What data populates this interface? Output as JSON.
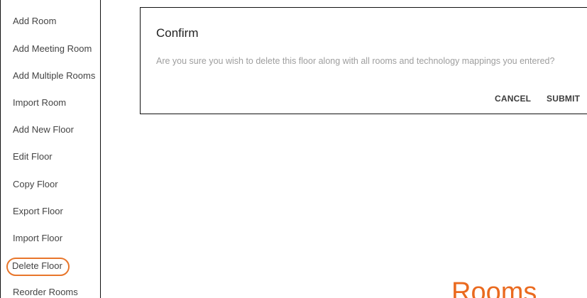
{
  "menu": {
    "items": [
      {
        "label": "Add Room"
      },
      {
        "label": "Add Meeting Room"
      },
      {
        "label": "Add Multiple Rooms"
      },
      {
        "label": "Import Room"
      },
      {
        "label": "Add New Floor"
      },
      {
        "label": "Edit Floor"
      },
      {
        "label": "Copy Floor"
      },
      {
        "label": "Export Floor"
      },
      {
        "label": "Import Floor"
      },
      {
        "label": "Delete Floor"
      },
      {
        "label": "Reorder Rooms"
      }
    ],
    "highlight_color": "#e8762b"
  },
  "dialog": {
    "title": "Confirm",
    "message": "Are you sure you wish to delete this floor along with all rooms and technology mappings you entered?",
    "cancel_label": "CANCEL",
    "submit_label": "SUBMIT"
  },
  "main": {
    "heading": "Rooms",
    "heading_color": "#ea6a1f"
  }
}
